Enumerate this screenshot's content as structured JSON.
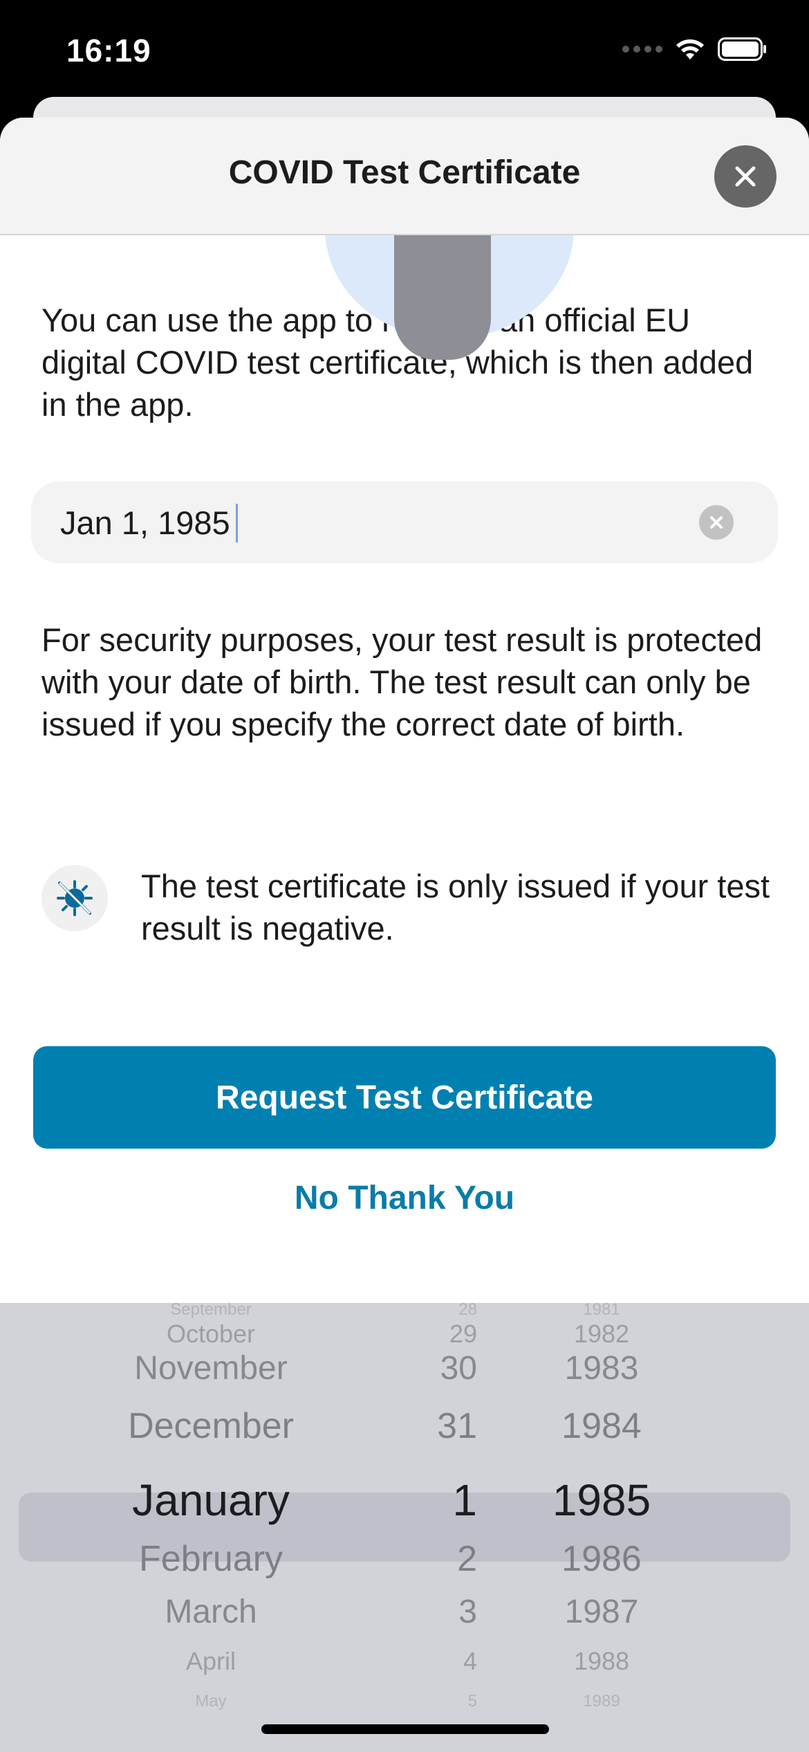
{
  "status_bar": {
    "time": "16:19"
  },
  "sheet": {
    "title": "COVID Test Certificate",
    "intro": "You can use the app to request an official EU digital COVID test certificate, which is then added in the app.",
    "birthdate_field": {
      "value": "Jan 1, 1985"
    },
    "security_text": "For security purposes, your test result is protected with your date of birth. The test result can only be issued if you specify the correct date of birth.",
    "notice": "The test certificate is only issued if your test result is negative.",
    "primary_button": "Request Test Certificate",
    "secondary_button": "No Thank You"
  },
  "picker": {
    "months": [
      "September",
      "October",
      "November",
      "December",
      "January",
      "February",
      "March",
      "April",
      "May"
    ],
    "days": [
      "28",
      "29",
      "30",
      "31",
      "1",
      "2",
      "3",
      "4",
      "5"
    ],
    "years": [
      "1981",
      "1982",
      "1983",
      "1984",
      "1985",
      "1986",
      "1987",
      "1988",
      "1989"
    ],
    "selected_index": 4
  },
  "colors": {
    "primary": "#0080b1",
    "link": "#0a7ca8",
    "picker_background": "#d1d3d9",
    "close_button": "#666666"
  },
  "icons": [
    "close-icon",
    "clear-icon",
    "virus-icon",
    "wifi-icon",
    "battery-icon",
    "signal-icon"
  ]
}
